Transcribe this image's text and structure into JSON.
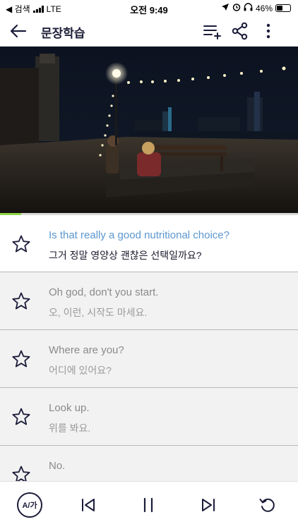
{
  "status": {
    "back_app": "◀ 검색",
    "carrier": "LTE",
    "time": "오전 9:49",
    "battery": "46%",
    "battery_level": 0.46
  },
  "appbar": {
    "title": "문장학습",
    "icons": [
      "back-arrow-icon",
      "playlist-add-icon",
      "share-icon",
      "more-vert-icon"
    ]
  },
  "video": {
    "progress": 0.07
  },
  "sentences": [
    {
      "en": "Is that really a good nutritional choice?",
      "ko": "그거 정말 영양상 괜찮은 선택일까요?",
      "active": true
    },
    {
      "en": "Oh god, don't you start.",
      "ko": "오, 이런, 시작도 마세요.",
      "active": false
    },
    {
      "en": "Where are you?",
      "ko": "어디에 있어요?",
      "active": false
    },
    {
      "en": "Look up.",
      "ko": "위를 봐요.",
      "active": false
    },
    {
      "en": "No.",
      "ko": "",
      "active": false
    }
  ],
  "controls": {
    "lang_toggle": "A/가",
    "icons": [
      "skip-previous-icon",
      "pause-icon",
      "skip-next-icon",
      "replay-icon"
    ]
  },
  "colors": {
    "accent_text": "#5b96cf",
    "progress": "#8fd64a",
    "dark": "#1b1b3a"
  }
}
